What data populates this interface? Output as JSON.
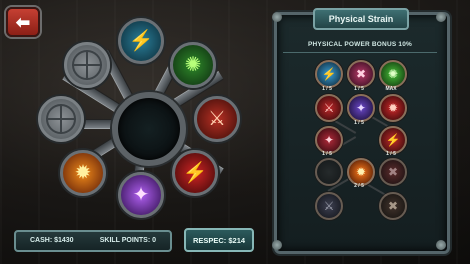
{
  "header": {
    "back_icon": "left-arrow-icon",
    "back_glyph": "⬅"
  },
  "wheel": {
    "nodes": [
      {
        "name": "locked-slot-top-left",
        "locked": true
      },
      {
        "name": "ice-slash",
        "icon": "ice-slash-icon",
        "glyph": "⚡",
        "color": "#40b7e0"
      },
      {
        "name": "green-blast",
        "icon": "green-blast-icon",
        "glyph": "✺",
        "color": "#3fcf4f"
      },
      {
        "name": "locked-slot-left",
        "locked": true
      },
      {
        "name": "fire-strike",
        "icon": "fire-strike-icon",
        "glyph": "⚔",
        "color": "#d03a2a"
      },
      {
        "name": "flame-burst",
        "icon": "flame-burst-icon",
        "glyph": "✹",
        "color": "#ff7a1a"
      },
      {
        "name": "purple-nova",
        "icon": "purple-nova-icon",
        "glyph": "✦",
        "color": "#b05ce8"
      },
      {
        "name": "crimson-rend",
        "icon": "crimson-rend-icon",
        "glyph": "⚡",
        "color": "#e02a2a"
      }
    ]
  },
  "panel": {
    "title": "Physical Strain",
    "subtitle": "PHYSICAL POWER BONUS 10%",
    "skills": [
      {
        "glyph": "⚡",
        "color": "#3aa0d8",
        "rank": "1 / 5"
      },
      {
        "glyph": "✖",
        "color": "#b83a6a",
        "rank": "1 / 5"
      },
      {
        "glyph": "✺",
        "color": "#48c03a",
        "rank": "MAX"
      },
      {
        "glyph": "⚔",
        "color": "#c0282a",
        "rank": ""
      },
      {
        "glyph": "✦",
        "color": "#6a48c8",
        "rank": "1 / 5"
      },
      {
        "glyph": "✹",
        "color": "#d0282a",
        "rank": ""
      },
      {
        "glyph": "✦",
        "color": "#b02a3a",
        "rank": "1 / 5"
      },
      {
        "glyph": "⚡",
        "color": "#c02a2a",
        "rank": "1 / 5"
      },
      {
        "glyph": "✹",
        "color": "#ff7a1a",
        "rank": "2 / 5"
      },
      {
        "glyph": "✖",
        "color": "#8a2a2a",
        "rank": ""
      },
      {
        "glyph": "⚔",
        "color": "#4a4a6a",
        "rank": ""
      },
      {
        "glyph": "✖",
        "color": "#5a3a2a",
        "rank": ""
      }
    ]
  },
  "footer": {
    "cash_label": "CASH: $1430",
    "skill_points_label": "SKILL POINTS: 0",
    "respec_label": "RESPEC: $214"
  }
}
